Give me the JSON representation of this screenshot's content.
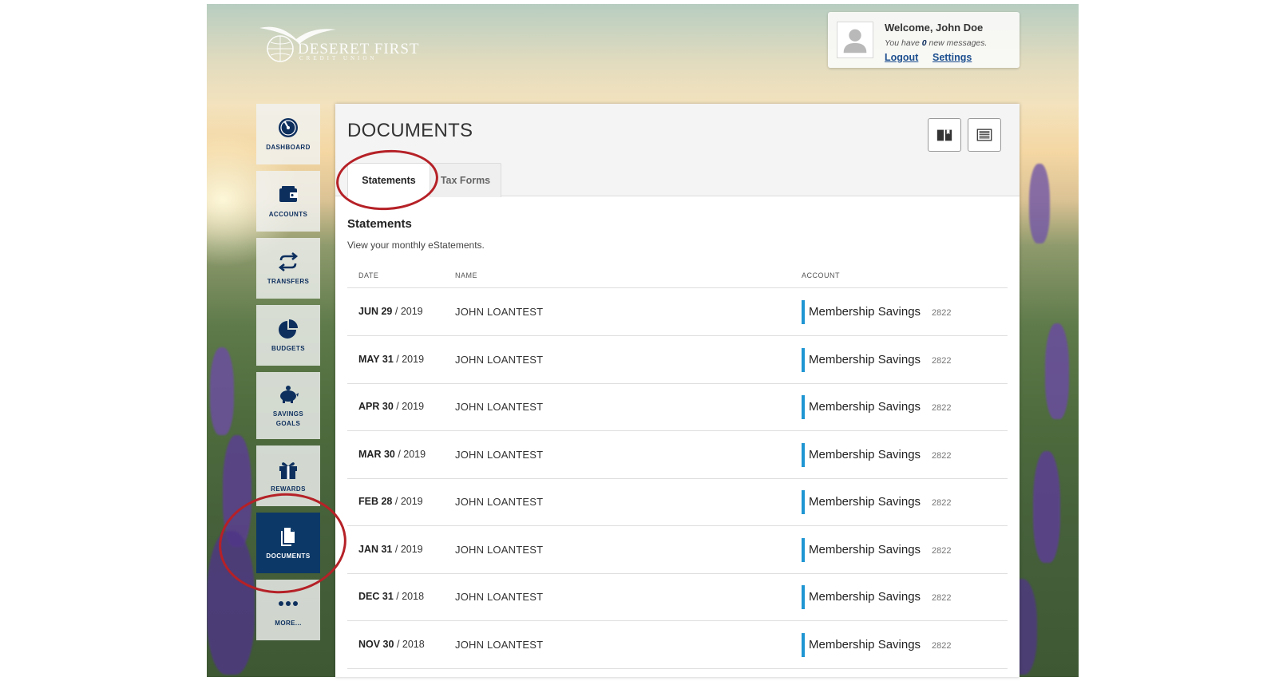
{
  "brand": {
    "name": "DESERET FIRST",
    "sub": "CREDIT UNION"
  },
  "user": {
    "welcome": "Welcome, John Doe",
    "messages_prefix": "You have",
    "messages_count": "0",
    "messages_suffix": "new messages.",
    "logout": "Logout",
    "settings": "Settings"
  },
  "nav": [
    {
      "label": "DASHBOARD",
      "icon": "dashboard-gauge-icon"
    },
    {
      "label": "ACCOUNTS",
      "icon": "wallet-icon"
    },
    {
      "label": "TRANSFERS",
      "icon": "transfer-arrows-icon"
    },
    {
      "label": "BUDGETS",
      "icon": "pie-chart-icon"
    },
    {
      "label": "SAVINGS GOALS",
      "icon": "piggy-bank-icon"
    },
    {
      "label": "REWARDS",
      "icon": "gift-icon"
    },
    {
      "label": "DOCUMENTS",
      "icon": "document-icon",
      "active": true
    },
    {
      "label": "MORE...",
      "icon": "more-dots-icon"
    }
  ],
  "page": {
    "title": "DOCUMENTS"
  },
  "tabs": [
    {
      "label": "Statements",
      "active": true
    },
    {
      "label": "Tax Forms",
      "active": false
    }
  ],
  "section": {
    "title": "Statements",
    "subtitle": "View your monthly eStatements."
  },
  "columns": {
    "date": "DATE",
    "name": "NAME",
    "account": "ACCOUNT"
  },
  "statements": [
    {
      "month_day": "JUN 29",
      "year": "/ 2019",
      "name": "JOHN LOANTEST",
      "account": "Membership Savings",
      "account_no": "2822"
    },
    {
      "month_day": "MAY 31",
      "year": "/ 2019",
      "name": "JOHN LOANTEST",
      "account": "Membership Savings",
      "account_no": "2822"
    },
    {
      "month_day": "APR 30",
      "year": "/ 2019",
      "name": "JOHN LOANTEST",
      "account": "Membership Savings",
      "account_no": "2822"
    },
    {
      "month_day": "MAR 30",
      "year": "/ 2019",
      "name": "JOHN LOANTEST",
      "account": "Membership Savings",
      "account_no": "2822"
    },
    {
      "month_day": "FEB 28",
      "year": "/ 2019",
      "name": "JOHN LOANTEST",
      "account": "Membership Savings",
      "account_no": "2822"
    },
    {
      "month_day": "JAN 31",
      "year": "/ 2019",
      "name": "JOHN LOANTEST",
      "account": "Membership Savings",
      "account_no": "2822"
    },
    {
      "month_day": "DEC 31",
      "year": "/ 2018",
      "name": "JOHN LOANTEST",
      "account": "Membership Savings",
      "account_no": "2822"
    },
    {
      "month_day": "NOV 30",
      "year": "/ 2018",
      "name": "JOHN LOANTEST",
      "account": "Membership Savings",
      "account_no": "2822"
    }
  ],
  "colors": {
    "accent": "#1f96d3",
    "nav_active": "#0c3867",
    "annotation": "#b52127",
    "nav_text": "#0d2f5e"
  }
}
